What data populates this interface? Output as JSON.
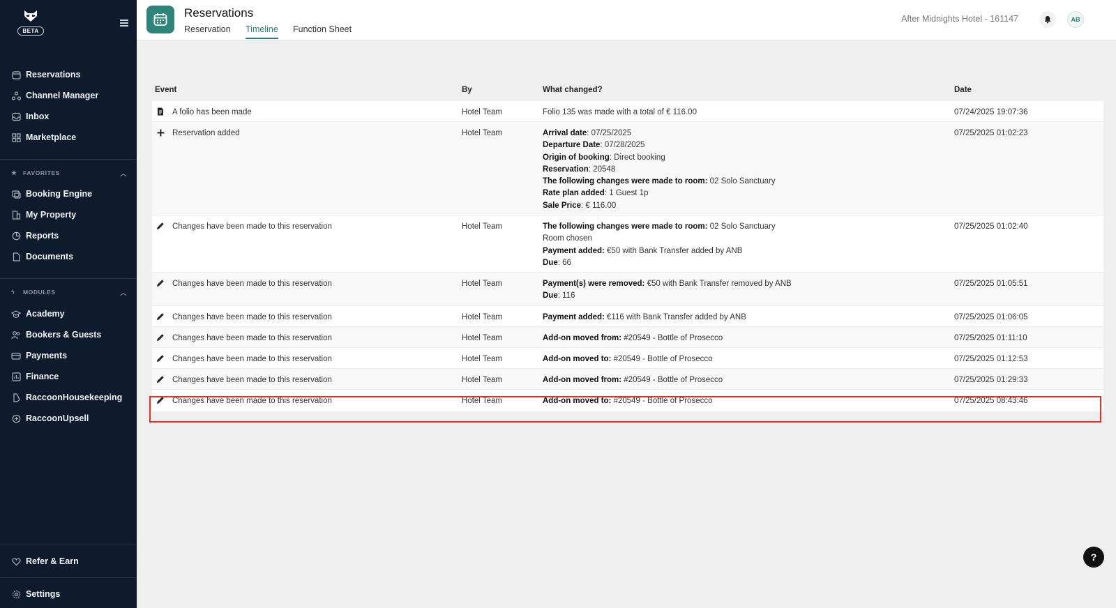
{
  "sidebar": {
    "beta": "BETA",
    "main_items": [
      {
        "label": "Reservations",
        "icon": "calendar-icon"
      },
      {
        "label": "Channel Manager",
        "icon": "channel-icon"
      },
      {
        "label": "Inbox",
        "icon": "inbox-icon"
      },
      {
        "label": "Marketplace",
        "icon": "grid-icon"
      }
    ],
    "favorites_title": "FAVORITES",
    "favorites": [
      {
        "label": "Booking Engine",
        "icon": "booking-icon"
      },
      {
        "label": "My Property",
        "icon": "building-icon"
      },
      {
        "label": "Reports",
        "icon": "pie-chart-icon"
      },
      {
        "label": "Documents",
        "icon": "document-icon"
      }
    ],
    "modules_title": "MODULES",
    "modules": [
      {
        "label": "Academy",
        "icon": "graduation-cap-icon"
      },
      {
        "label": "Bookers & Guests",
        "icon": "users-icon"
      },
      {
        "label": "Payments",
        "icon": "card-icon"
      },
      {
        "label": "Finance",
        "icon": "finance-icon"
      },
      {
        "label": "RaccoonHousekeeping",
        "icon": "housekeeping-icon"
      },
      {
        "label": "RaccoonUpsell",
        "icon": "plus-circle-icon"
      }
    ],
    "refer": "Refer & Earn",
    "settings": "Settings"
  },
  "header": {
    "title": "Reservations",
    "tabs": [
      "Reservation",
      "Timeline",
      "Function Sheet"
    ],
    "active_tab": "Timeline",
    "hotel": "After Midnights Hotel - 161147",
    "avatar": "AB"
  },
  "table": {
    "headers": {
      "event": "Event",
      "by": "By",
      "what": "What changed?",
      "date": "Date"
    },
    "rows": [
      {
        "icon": "document-icon",
        "event": "A folio has been made",
        "by": "Hotel Team",
        "changes": [
          {
            "label": "",
            "value": "Folio 135 was made with a total of € 116.00"
          }
        ],
        "date": "07/24/2025 19:07:36"
      },
      {
        "icon": "plus-icon",
        "event": "Reservation added",
        "by": "Hotel Team",
        "changes": [
          {
            "label": "Arrival date",
            "value": ": 07/25/2025"
          },
          {
            "label": "Departure Date",
            "value": ": 07/28/2025"
          },
          {
            "label": "Origin of booking",
            "value": ": Direct booking"
          },
          {
            "label": "Reservation",
            "value": ": 20548"
          },
          {
            "label": "The following changes were made to room:",
            "value": " 02 Solo Sanctuary"
          },
          {
            "label": "Rate plan added",
            "value": ": 1 Guest 1p"
          },
          {
            "label": "Sale Price",
            "value": ": € 116.00"
          }
        ],
        "date": "07/25/2025 01:02:23"
      },
      {
        "icon": "pencil-icon",
        "event": "Changes have been made to this reservation",
        "by": "Hotel Team",
        "changes": [
          {
            "label": "The following changes were made to room:",
            "value": " 02 Solo Sanctuary"
          },
          {
            "label": "",
            "value": "Room chosen"
          },
          {
            "label": "Payment added:",
            "value": " €50 with Bank Transfer added by ANB"
          },
          {
            "label": "Due",
            "value": ": 66"
          }
        ],
        "date": "07/25/2025 01:02:40"
      },
      {
        "icon": "pencil-icon",
        "event": "Changes have been made to this reservation",
        "by": "Hotel Team",
        "changes": [
          {
            "label": "Payment(s) were removed:",
            "value": " €50 with Bank Transfer removed by ANB"
          },
          {
            "label": "Due",
            "value": ": 116"
          }
        ],
        "date": "07/25/2025 01:05:51"
      },
      {
        "icon": "pencil-icon",
        "event": "Changes have been made to this reservation",
        "by": "Hotel Team",
        "changes": [
          {
            "label": "Payment added:",
            "value": " €116 with Bank Transfer added by ANB"
          }
        ],
        "date": "07/25/2025 01:06:05"
      },
      {
        "icon": "pencil-icon",
        "event": "Changes have been made to this reservation",
        "by": "Hotel Team",
        "changes": [
          {
            "label": "Add-on moved from:",
            "value": " #20549 - Bottle of Prosecco"
          }
        ],
        "date": "07/25/2025 01:11:10"
      },
      {
        "icon": "pencil-icon",
        "event": "Changes have been made to this reservation",
        "by": "Hotel Team",
        "changes": [
          {
            "label": "Add-on moved to:",
            "value": " #20549 - Bottle of Prosecco"
          }
        ],
        "date": "07/25/2025 01:12:53"
      },
      {
        "icon": "pencil-icon",
        "event": "Changes have been made to this reservation",
        "by": "Hotel Team",
        "changes": [
          {
            "label": "Add-on moved from:",
            "value": " #20549 - Bottle of Prosecco"
          }
        ],
        "date": "07/25/2025 01:29:33"
      },
      {
        "icon": "pencil-icon",
        "event": "Changes have been made to this reservation",
        "by": "Hotel Team",
        "changes": [
          {
            "label": "Add-on moved to:",
            "value": " #20549 - Bottle of Prosecco"
          }
        ],
        "date": "07/25/2025 08:43:46"
      }
    ]
  },
  "help": "?",
  "colors": {
    "sidebar": "#0f1b2c",
    "accent": "#2a7f74",
    "highlight": "#e03125"
  }
}
